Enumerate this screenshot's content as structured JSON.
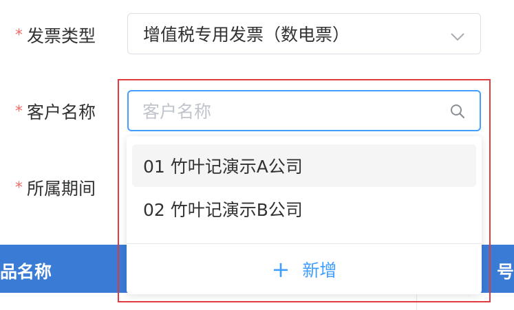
{
  "form": {
    "required_mark": "*",
    "invoice_type": {
      "label": "发票类型",
      "value": "增值税专用发票（数电票）"
    },
    "customer_name": {
      "label": "客户名称",
      "placeholder": "客户名称"
    },
    "period": {
      "label": "所属期间"
    }
  },
  "dropdown": {
    "options": [
      {
        "label": "01 竹叶记演示A公司"
      },
      {
        "label": "02 竹叶记演示B公司"
      }
    ],
    "add_label": "新增",
    "add_icon": "plus-icon"
  },
  "table": {
    "header_left": "品名称",
    "header_right": "号"
  },
  "colors": {
    "primary": "#409eff",
    "header_bg": "#3a7bd5",
    "required": "#f56c6c",
    "highlight": "#e0393e"
  }
}
